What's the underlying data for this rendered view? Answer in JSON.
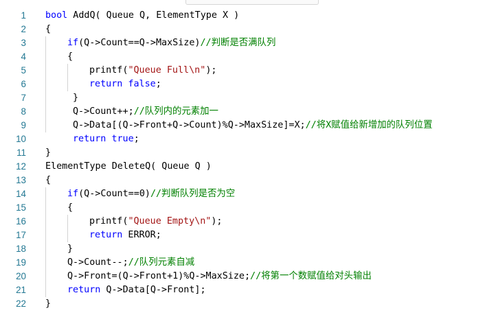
{
  "editor": {
    "lines": [
      {
        "n": "1",
        "indent": 0,
        "tokens": [
          {
            "t": "bool",
            "c": "kw"
          },
          {
            "t": " AddQ( Queue Q, ElementType X )",
            "c": "tx"
          }
        ]
      },
      {
        "n": "2",
        "indent": 0,
        "tokens": [
          {
            "t": "{",
            "c": "tx"
          }
        ]
      },
      {
        "n": "3",
        "indent": 1,
        "tokens": [
          {
            "t": "if",
            "c": "kw"
          },
          {
            "t": "(Q->Count==Q->MaxSize)",
            "c": "tx"
          },
          {
            "t": "//判断是否满队列",
            "c": "cm"
          }
        ]
      },
      {
        "n": "4",
        "indent": 1,
        "tokens": [
          {
            "t": "{",
            "c": "tx"
          }
        ]
      },
      {
        "n": "5",
        "indent": 2,
        "tokens": [
          {
            "t": "printf(",
            "c": "tx"
          },
          {
            "t": "\"Queue Full\\n\"",
            "c": "str"
          },
          {
            "t": ");",
            "c": "tx"
          }
        ]
      },
      {
        "n": "6",
        "indent": 2,
        "tokens": [
          {
            "t": "return",
            "c": "kw"
          },
          {
            "t": " ",
            "c": "tx"
          },
          {
            "t": "false",
            "c": "kw"
          },
          {
            "t": ";",
            "c": "tx"
          }
        ]
      },
      {
        "n": "7",
        "indent": 1,
        "pad": 1,
        "tokens": [
          {
            "t": "}",
            "c": "tx"
          }
        ]
      },
      {
        "n": "8",
        "indent": 1,
        "pad": 1,
        "tokens": [
          {
            "t": "Q->Count++;",
            "c": "tx"
          },
          {
            "t": "//队列内的元素加一",
            "c": "cm"
          }
        ]
      },
      {
        "n": "9",
        "indent": 1,
        "pad": 1,
        "tokens": [
          {
            "t": "Q->Data[(Q->Front+Q->Count)%Q->MaxSize]=X;",
            "c": "tx"
          },
          {
            "t": "//将X赋值给新增加的队列位置",
            "c": "cm"
          }
        ]
      },
      {
        "n": "10",
        "indent": 1,
        "pad": 1,
        "tokens": [
          {
            "t": "return",
            "c": "kw"
          },
          {
            "t": " ",
            "c": "tx"
          },
          {
            "t": "true",
            "c": "kw"
          },
          {
            "t": ";",
            "c": "tx"
          }
        ]
      },
      {
        "n": "11",
        "indent": 0,
        "tokens": [
          {
            "t": "}",
            "c": "tx"
          }
        ]
      },
      {
        "n": "12",
        "indent": 0,
        "tokens": [
          {
            "t": "ElementType DeleteQ( Queue Q )",
            "c": "tx"
          }
        ]
      },
      {
        "n": "13",
        "indent": 0,
        "tokens": [
          {
            "t": "{",
            "c": "tx"
          }
        ]
      },
      {
        "n": "14",
        "indent": 1,
        "tokens": [
          {
            "t": "if",
            "c": "kw"
          },
          {
            "t": "(Q->Count==",
            "c": "tx"
          },
          {
            "t": "0",
            "c": "tx"
          },
          {
            "t": ")",
            "c": "tx"
          },
          {
            "t": "//判断队列是否为空",
            "c": "cm"
          }
        ]
      },
      {
        "n": "15",
        "indent": 1,
        "tokens": [
          {
            "t": "{",
            "c": "tx"
          }
        ]
      },
      {
        "n": "16",
        "indent": 2,
        "tokens": [
          {
            "t": "printf(",
            "c": "tx"
          },
          {
            "t": "\"Queue Empty\\n\"",
            "c": "str"
          },
          {
            "t": ");",
            "c": "tx"
          }
        ]
      },
      {
        "n": "17",
        "indent": 2,
        "tokens": [
          {
            "t": "return",
            "c": "kw"
          },
          {
            "t": " ERROR;",
            "c": "tx"
          }
        ]
      },
      {
        "n": "18",
        "indent": 1,
        "tokens": [
          {
            "t": "}",
            "c": "tx"
          }
        ]
      },
      {
        "n": "19",
        "indent": 1,
        "tokens": [
          {
            "t": "Q->Count--;",
            "c": "tx"
          },
          {
            "t": "//队列元素自减",
            "c": "cm"
          }
        ]
      },
      {
        "n": "20",
        "indent": 1,
        "tokens": [
          {
            "t": "Q->Front=(Q->Front+1)%Q->MaxSize;",
            "c": "tx"
          },
          {
            "t": "//将第一个数赋值给对头输出",
            "c": "cm"
          }
        ]
      },
      {
        "n": "21",
        "indent": 1,
        "tokens": [
          {
            "t": "return",
            "c": "kw"
          },
          {
            "t": " Q->Data[Q->Front];",
            "c": "tx"
          }
        ]
      },
      {
        "n": "22",
        "indent": 0,
        "tokens": [
          {
            "t": "}",
            "c": "tx"
          }
        ]
      }
    ]
  }
}
